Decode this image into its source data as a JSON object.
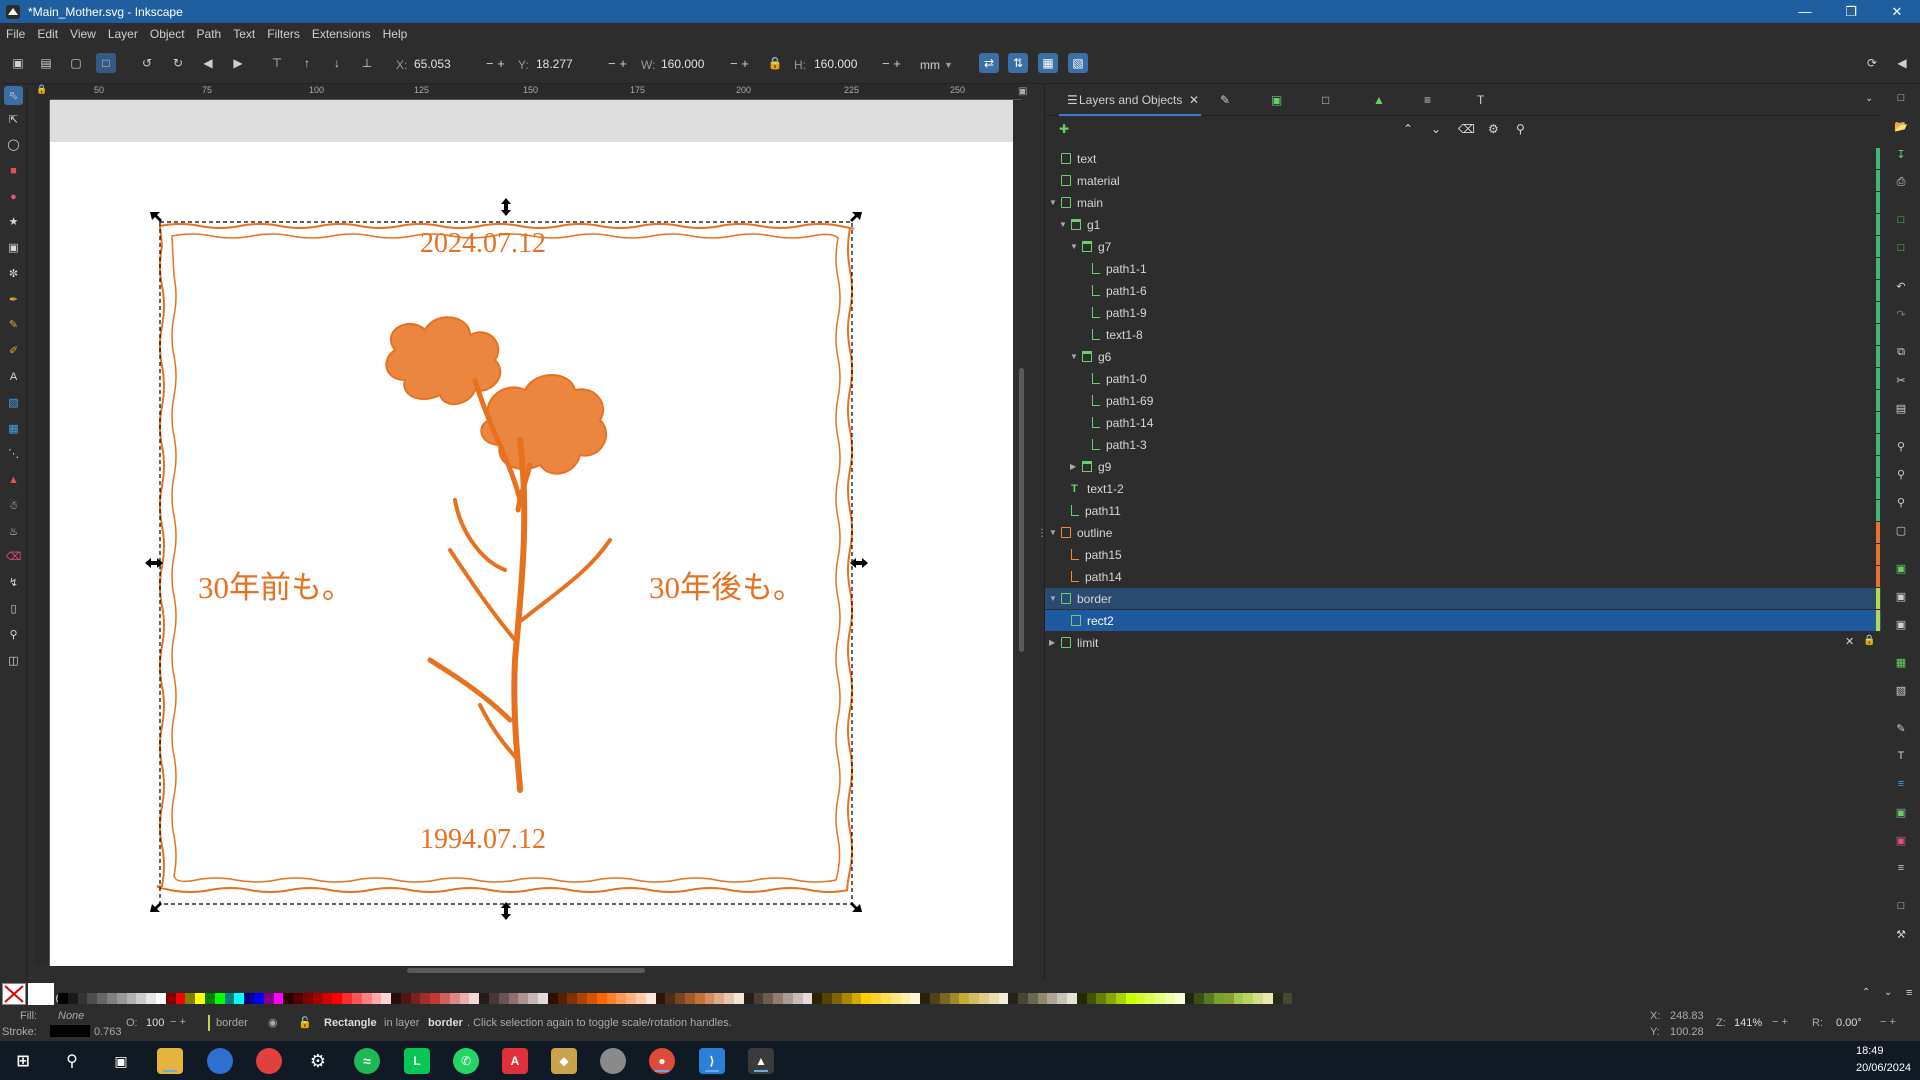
{
  "window": {
    "title": "*Main_Mother.svg - Inkscape"
  },
  "menu": [
    "File",
    "Edit",
    "View",
    "Layer",
    "Object",
    "Path",
    "Text",
    "Filters",
    "Extensions",
    "Help"
  ],
  "controls": {
    "x_label": "X:",
    "x_value": "65.053",
    "y_label": "Y:",
    "y_value": "18.277",
    "w_label": "W:",
    "w_value": "160.000",
    "h_label": "H:",
    "h_value": "160.000",
    "unit": "mm"
  },
  "ruler_top": [
    "50",
    "75",
    "100",
    "125",
    "150",
    "175",
    "200",
    "225",
    "250"
  ],
  "artwork": {
    "date_top": "2024.07.12",
    "date_bottom": "1994.07.12",
    "left_text": "30年前も。",
    "right_text": "30年後も。",
    "accent": "#e8711f"
  },
  "panel": {
    "tab_title": "Layers and Objects",
    "tree": [
      {
        "label": "text",
        "type": "layer"
      },
      {
        "label": "material",
        "type": "layer"
      },
      {
        "label": "main",
        "type": "layer"
      },
      {
        "label": "g1",
        "type": "group"
      },
      {
        "label": "g7",
        "type": "group"
      },
      {
        "label": "path1-1",
        "type": "path"
      },
      {
        "label": "path1-6",
        "type": "path"
      },
      {
        "label": "path1-9",
        "type": "path"
      },
      {
        "label": "text1-8",
        "type": "path"
      },
      {
        "label": "g6",
        "type": "group"
      },
      {
        "label": "path1-0",
        "type": "path"
      },
      {
        "label": "path1-69",
        "type": "path"
      },
      {
        "label": "path1-14",
        "type": "path"
      },
      {
        "label": "path1-3",
        "type": "path"
      },
      {
        "label": "g9",
        "type": "group"
      },
      {
        "label": "text1-2",
        "type": "text"
      },
      {
        "label": "path11",
        "type": "path"
      },
      {
        "label": "outline",
        "type": "layer-orange"
      },
      {
        "label": "path15",
        "type": "path-orange"
      },
      {
        "label": "path14",
        "type": "path-orange"
      },
      {
        "label": "border",
        "type": "layer"
      },
      {
        "label": "rect2",
        "type": "rect"
      },
      {
        "label": "limit",
        "type": "layer"
      }
    ]
  },
  "status": {
    "fill_label": "Fill:",
    "fill_value": "None",
    "stroke_label": "Stroke:",
    "stroke_width": "0.763",
    "opacity_label": "O:",
    "opacity_value": "100",
    "layer_name": "border",
    "message_bold": "Rectangle",
    "message_rest": " in layer ",
    "message_layer": "border",
    "message_tail": ". Click selection again to toggle scale/rotation handles.",
    "cursor_x_label": "X:",
    "cursor_x": "248.83",
    "cursor_y_label": "Y:",
    "cursor_y": "100.28",
    "zoom_label": "Z:",
    "zoom": "141%",
    "rotation_label": "R:",
    "rotation": "0.00°"
  },
  "taskbar": {
    "time": "18:49",
    "date": "20/06/2024"
  }
}
